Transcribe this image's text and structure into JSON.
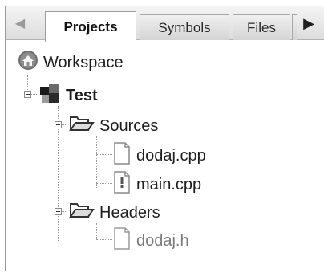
{
  "tabs": [
    {
      "label": "Projects",
      "active": true
    },
    {
      "label": "Symbols",
      "active": false
    },
    {
      "label": "Files",
      "active": false
    }
  ],
  "tree": {
    "workspace": {
      "label": "Workspace",
      "icon": "workspace-icon"
    },
    "project": {
      "label": "Test",
      "icon": "project-icon"
    },
    "sources": {
      "label": "Sources",
      "icon": "folder-open-icon"
    },
    "source_files": [
      {
        "label": "dodaj.cpp",
        "icon": "file-icon"
      },
      {
        "label": "main.cpp",
        "icon": "file-modified-icon"
      }
    ],
    "headers": {
      "label": "Headers",
      "icon": "folder-open-icon"
    },
    "header_files": [
      {
        "label": "dodaj.h",
        "icon": "file-icon"
      }
    ]
  },
  "colors": {
    "tab_bar": "#dddddd",
    "tree_line": "#9a9a9a",
    "dim_text": "#7a7a7a"
  }
}
